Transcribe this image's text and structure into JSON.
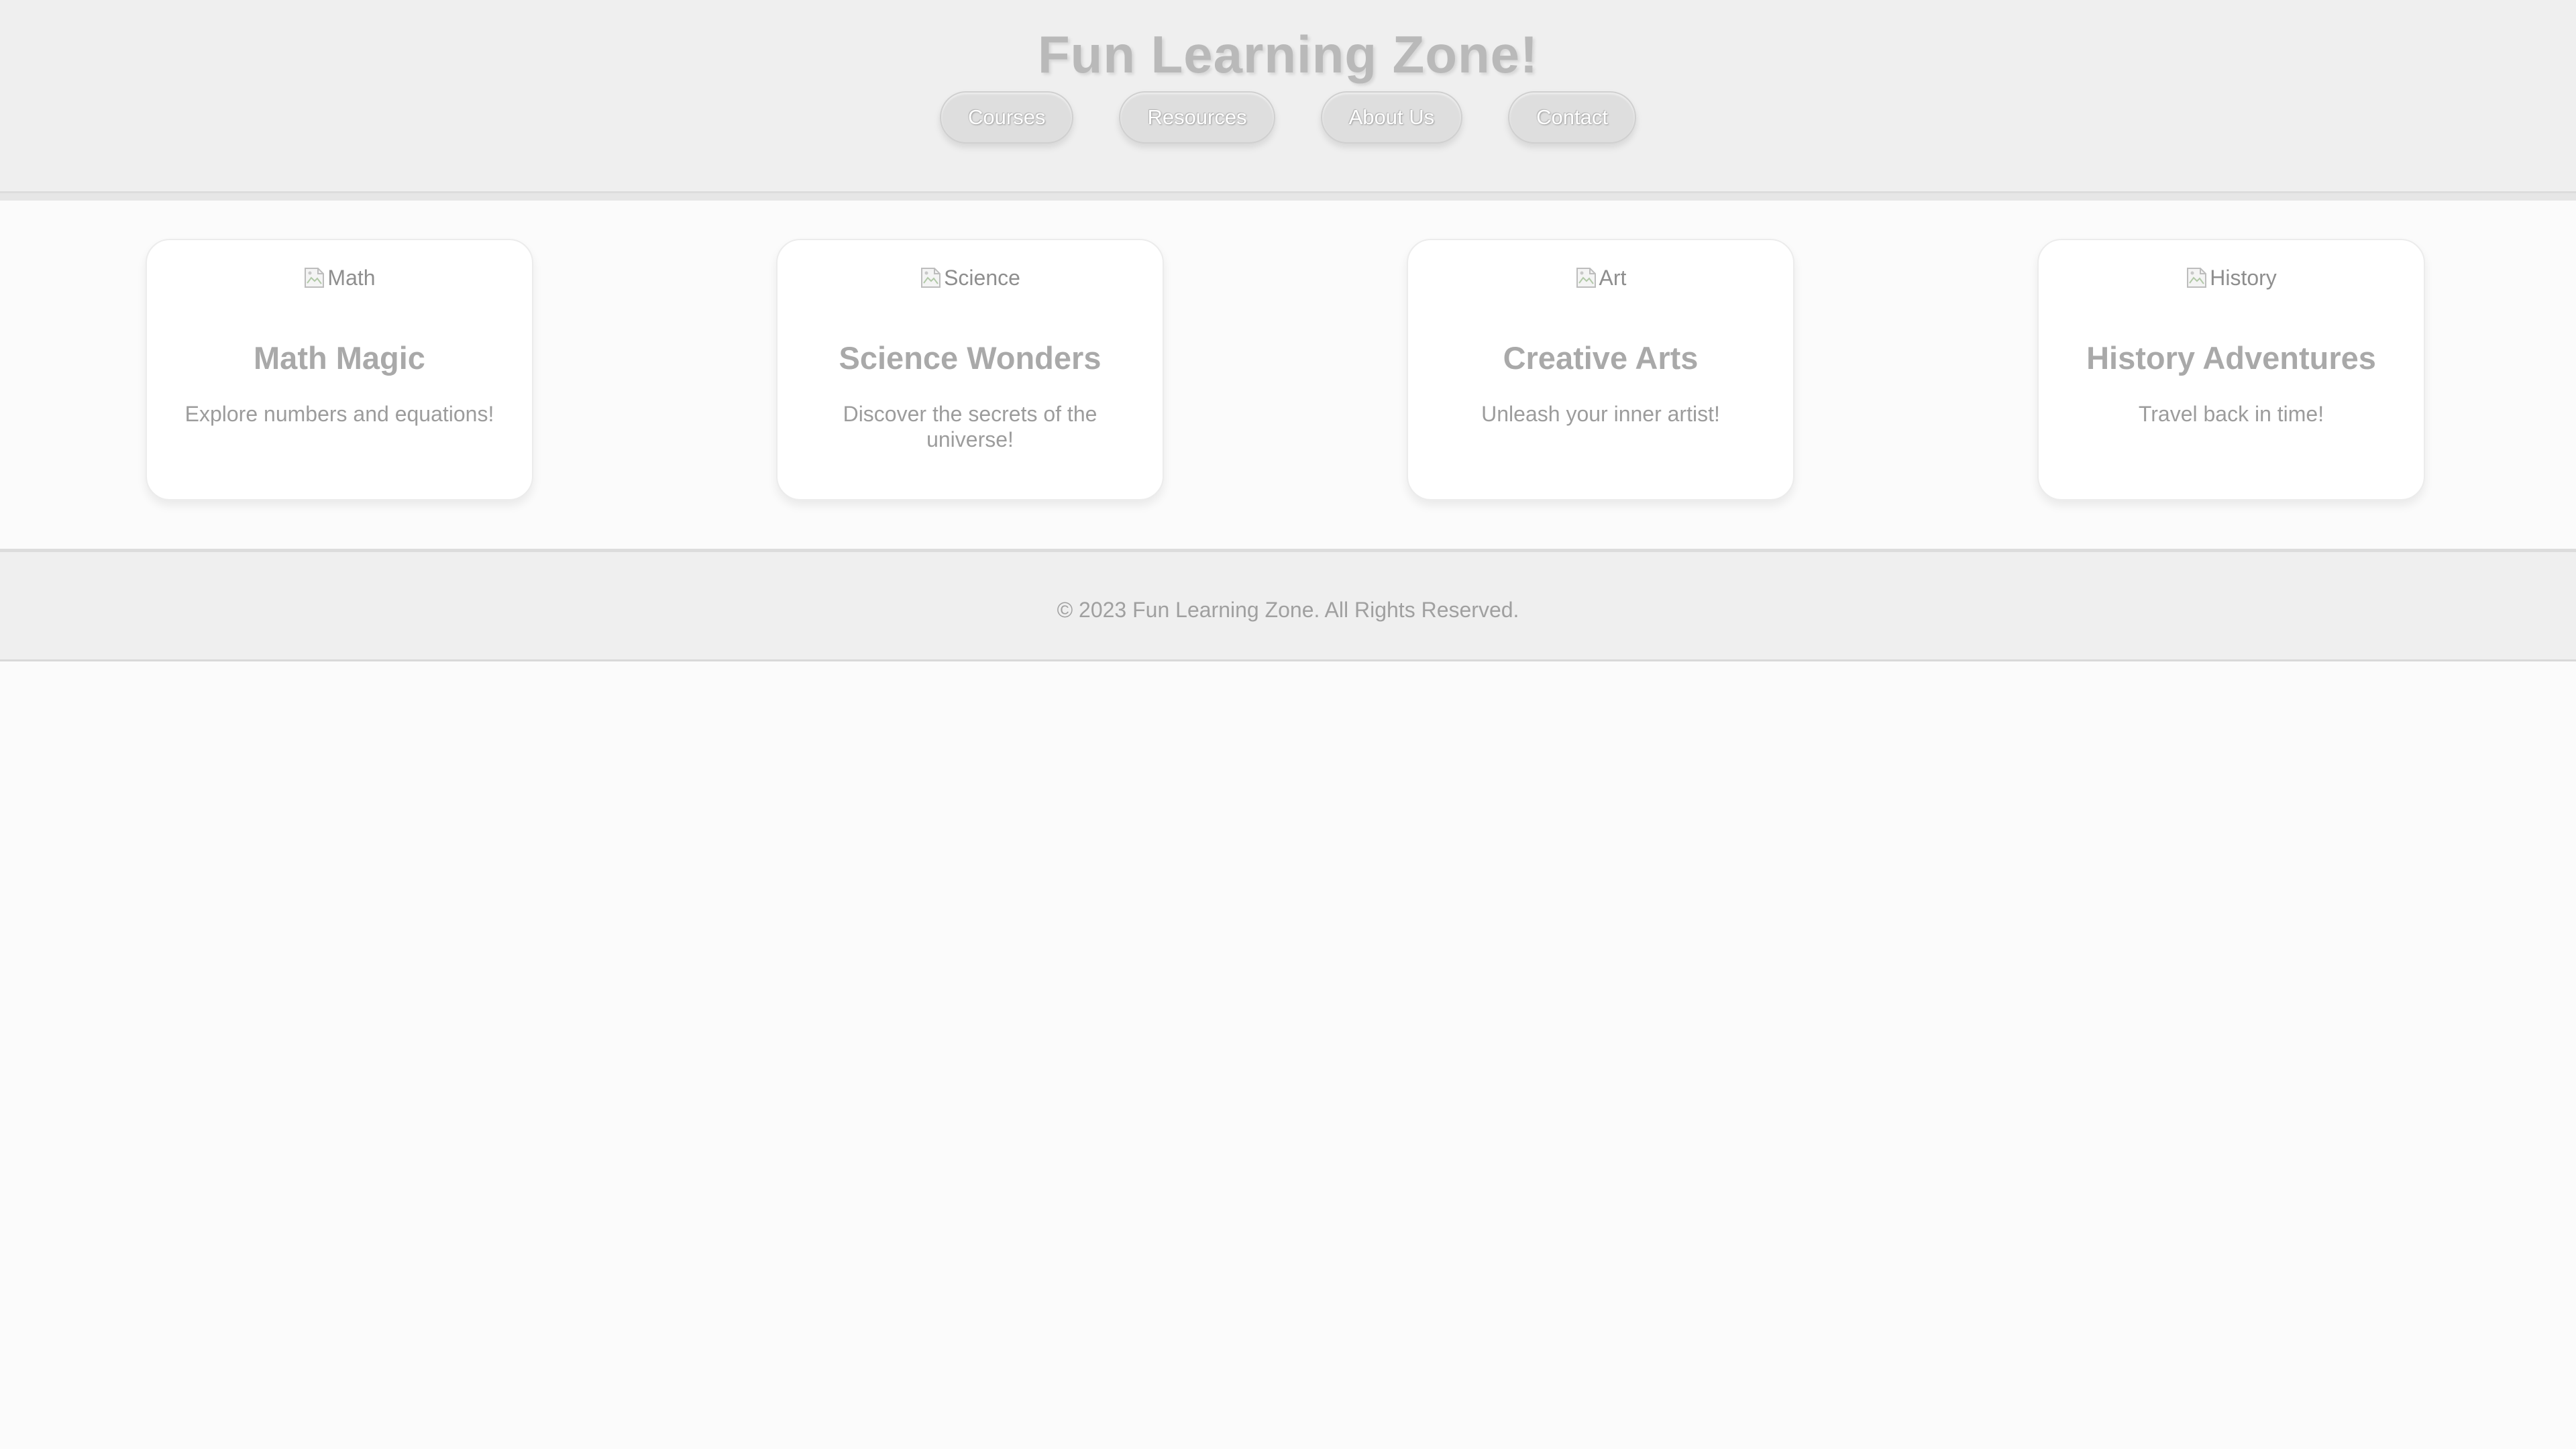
{
  "header": {
    "title": "Fun Learning Zone!",
    "nav": [
      {
        "label": "Courses"
      },
      {
        "label": "Resources"
      },
      {
        "label": "About Us"
      },
      {
        "label": "Contact"
      }
    ]
  },
  "cards": [
    {
      "image_alt": "Math",
      "title": "Math Magic",
      "description": "Explore numbers and equations!"
    },
    {
      "image_alt": "Science",
      "title": "Science Wonders",
      "description": "Discover the secrets of the universe!"
    },
    {
      "image_alt": "Art",
      "title": "Creative Arts",
      "description": "Unleash your inner artist!"
    },
    {
      "image_alt": "History",
      "title": "History Adventures",
      "description": "Travel back in time!"
    }
  ],
  "footer": {
    "text": "© 2023 Fun Learning Zone. All Rights Reserved."
  },
  "icons": {
    "card_image": "broken-image-icon"
  },
  "colors": {
    "header_bg": "#efefef",
    "page_bg": "#fbfbfb",
    "card_bg": "#ffffff",
    "title_text": "#b9b9b9",
    "nav_button_bg": "#dedede"
  }
}
